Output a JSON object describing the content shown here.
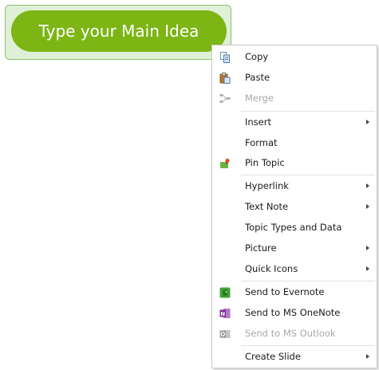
{
  "topic": {
    "label": "Type your Main Idea"
  },
  "colors": {
    "topic_fill": "#7cb514",
    "topic_selection": "#dff0d6",
    "menu_border": "#c9c9c9",
    "disabled_text": "#a8a8a8"
  },
  "context_menu": {
    "items": [
      {
        "label": "Copy",
        "icon": "copy-icon",
        "enabled": true,
        "submenu": false
      },
      {
        "label": "Paste",
        "icon": "paste-icon",
        "enabled": true,
        "submenu": false
      },
      {
        "label": "Merge",
        "icon": "merge-icon",
        "enabled": false,
        "submenu": false
      },
      {
        "label": "Insert",
        "icon": null,
        "enabled": true,
        "submenu": true
      },
      {
        "label": "Format",
        "icon": null,
        "enabled": true,
        "submenu": false
      },
      {
        "label": "Pin Topic",
        "icon": "pin-topic-icon",
        "enabled": true,
        "submenu": false
      },
      {
        "label": "Hyperlink",
        "icon": null,
        "enabled": true,
        "submenu": true
      },
      {
        "label": "Text Note",
        "icon": null,
        "enabled": true,
        "submenu": true
      },
      {
        "label": "Topic Types and Data",
        "icon": null,
        "enabled": true,
        "submenu": false
      },
      {
        "label": "Picture",
        "icon": null,
        "enabled": true,
        "submenu": true
      },
      {
        "label": "Quick Icons",
        "icon": null,
        "enabled": true,
        "submenu": true
      },
      {
        "label": "Send to Evernote",
        "icon": "evernote-icon",
        "enabled": true,
        "submenu": false
      },
      {
        "label": "Send to MS OneNote",
        "icon": "onenote-icon",
        "enabled": true,
        "submenu": false
      },
      {
        "label": "Send to MS Outlook",
        "icon": "outlook-icon",
        "enabled": false,
        "submenu": false
      },
      {
        "label": "Create Slide",
        "icon": null,
        "enabled": true,
        "submenu": true
      }
    ]
  }
}
